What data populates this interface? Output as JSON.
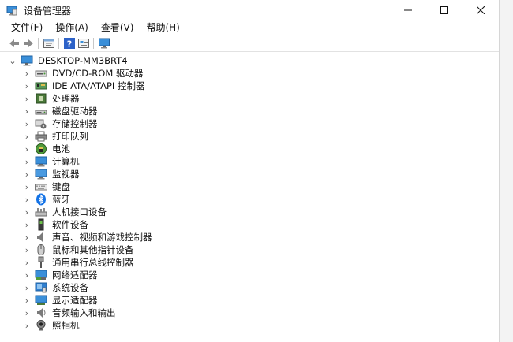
{
  "window": {
    "title": "设备管理器",
    "controls": {
      "minimize": "—",
      "maximize": "☐",
      "close": "✕"
    }
  },
  "menu": [
    {
      "label": "文件(F)"
    },
    {
      "label": "操作(A)"
    },
    {
      "label": "查看(V)"
    },
    {
      "label": "帮助(H)"
    }
  ],
  "toolbar": {
    "buttons": [
      "back-arrow-icon",
      "forward-arrow-icon",
      "properties-icon",
      "help-icon",
      "device-view-icon",
      "monitor-scan-icon"
    ]
  },
  "tree": {
    "root": {
      "label": "DESKTOP-MM3BRT4",
      "expanded": true,
      "icon": "computer-icon"
    },
    "categories": [
      {
        "label": "DVD/CD-ROM 驱动器",
        "icon": "dvd-drive-icon"
      },
      {
        "label": "IDE ATA/ATAPI 控制器",
        "icon": "ide-controller-icon"
      },
      {
        "label": "处理器",
        "icon": "processor-icon"
      },
      {
        "label": "磁盘驱动器",
        "icon": "disk-drive-icon"
      },
      {
        "label": "存储控制器",
        "icon": "storage-controller-icon"
      },
      {
        "label": "打印队列",
        "icon": "printer-icon"
      },
      {
        "label": "电池",
        "icon": "battery-icon"
      },
      {
        "label": "计算机",
        "icon": "computer-icon"
      },
      {
        "label": "监视器",
        "icon": "monitor-icon"
      },
      {
        "label": "键盘",
        "icon": "keyboard-icon"
      },
      {
        "label": "蓝牙",
        "icon": "bluetooth-icon"
      },
      {
        "label": "人机接口设备",
        "icon": "hid-icon"
      },
      {
        "label": "软件设备",
        "icon": "software-device-icon"
      },
      {
        "label": "声音、视频和游戏控制器",
        "icon": "speaker-icon"
      },
      {
        "label": "鼠标和其他指针设备",
        "icon": "mouse-icon"
      },
      {
        "label": "通用串行总线控制器",
        "icon": "usb-icon"
      },
      {
        "label": "网络适配器",
        "icon": "network-adapter-icon"
      },
      {
        "label": "系统设备",
        "icon": "system-device-icon"
      },
      {
        "label": "显示适配器",
        "icon": "display-adapter-icon"
      },
      {
        "label": "音频输入和输出",
        "icon": "audio-io-icon"
      },
      {
        "label": "照相机",
        "icon": "camera-icon"
      }
    ]
  },
  "colors": {
    "accent": "#1e7fd6",
    "bluetooth": "#1473e6",
    "help": "#2d62c8"
  }
}
